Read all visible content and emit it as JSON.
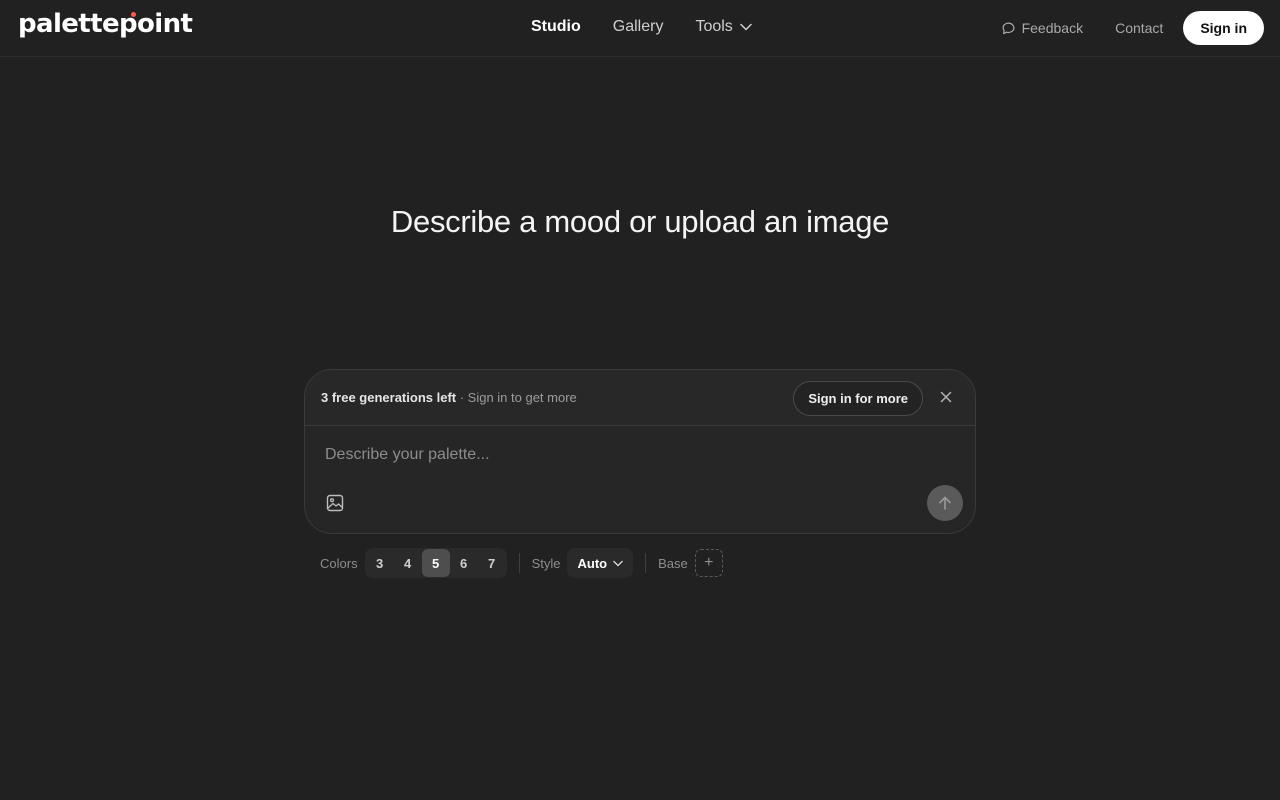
{
  "header": {
    "logo": "palettepoint",
    "nav": [
      {
        "label": "Studio",
        "active": true
      },
      {
        "label": "Gallery",
        "active": false
      },
      {
        "label": "Tools",
        "active": false,
        "has_dropdown": true
      }
    ],
    "feedback_label": "Feedback",
    "contact_label": "Contact",
    "signin_label": "Sign in"
  },
  "main": {
    "headline": "Describe a mood or upload an image"
  },
  "composer": {
    "banner": {
      "strong_text": "3 free generations left",
      "rest_text": " · Sign in to get more",
      "button_label": "Sign in for more"
    },
    "input": {
      "placeholder": "Describe your palette...",
      "value": ""
    }
  },
  "options": {
    "colors_label": "Colors",
    "color_counts": [
      "3",
      "4",
      "5",
      "6",
      "7"
    ],
    "selected_count": "5",
    "style_label": "Style",
    "style_value": "Auto",
    "base_label": "Base",
    "base_add_symbol": "+"
  },
  "icons": {
    "feedback": "speech-bubble-icon",
    "dropdown": "chevron-down-icon",
    "close": "close-icon",
    "image": "image-icon",
    "send": "arrow-up-icon"
  },
  "colors": {
    "background": "#212121",
    "logo_accent": "#ff5a4e",
    "send_button": "#5a5a5a"
  }
}
